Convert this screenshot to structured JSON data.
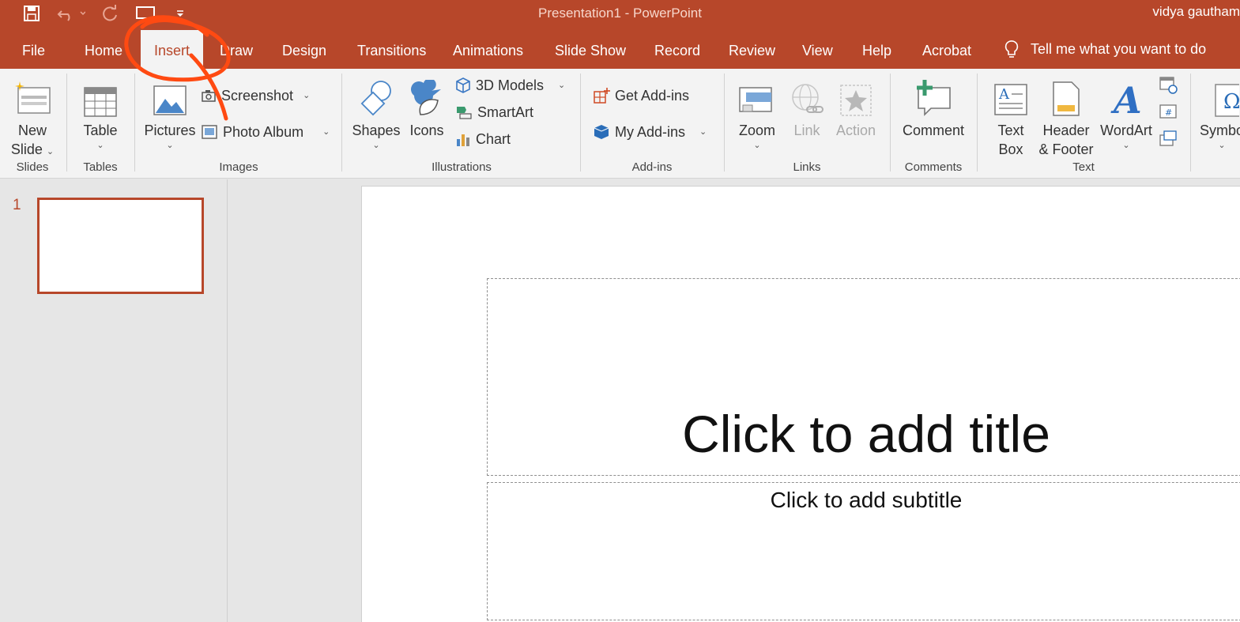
{
  "app": {
    "doc_title": "Presentation1  -  PowerPoint",
    "user_name": "vidya gautham",
    "accent_color": "#b7472a",
    "annotation_color": "#ff4a12"
  },
  "quick_access": [
    {
      "name": "save-icon"
    },
    {
      "name": "undo-icon"
    },
    {
      "name": "redo-icon"
    },
    {
      "name": "present-from-start-icon"
    },
    {
      "name": "customize-qat-icon"
    }
  ],
  "tabs": [
    "File",
    "Home",
    "Insert",
    "Draw",
    "Design",
    "Transitions",
    "Animations",
    "Slide Show",
    "Record",
    "Review",
    "View",
    "Help",
    "Acrobat"
  ],
  "active_tab": "Insert",
  "tell_me": "Tell me what you want to do",
  "ribbon": {
    "slides": {
      "label": "Slides",
      "new_slide": "New",
      "new_slide2": "Slide"
    },
    "tables": {
      "label": "Tables",
      "table": "Table"
    },
    "images": {
      "label": "Images",
      "pictures": "Pictures",
      "screenshot": "Screenshot",
      "photo_album": "Photo Album"
    },
    "illustrations": {
      "label": "Illustrations",
      "shapes": "Shapes",
      "icons": "Icons",
      "models3d": "3D Models",
      "smartart": "SmartArt",
      "chart": "Chart"
    },
    "addins": {
      "label": "Add-ins",
      "get_addins": "Get Add-ins",
      "my_addins": "My Add-ins"
    },
    "links": {
      "label": "Links",
      "zoom": "Zoom",
      "link": "Link",
      "action": "Action"
    },
    "comments": {
      "label": "Comments",
      "comment": "Comment"
    },
    "text": {
      "label": "Text",
      "textbox1": "Text",
      "textbox2": "Box",
      "header1": "Header",
      "header2": "& Footer",
      "wordart": "WordArt"
    },
    "symbols": {
      "symbols": "Symbo"
    }
  },
  "thumbnails": {
    "slide_number": "1"
  },
  "slide": {
    "title_placeholder": "Click to add title",
    "subtitle_placeholder": "Click to add subtitle"
  }
}
